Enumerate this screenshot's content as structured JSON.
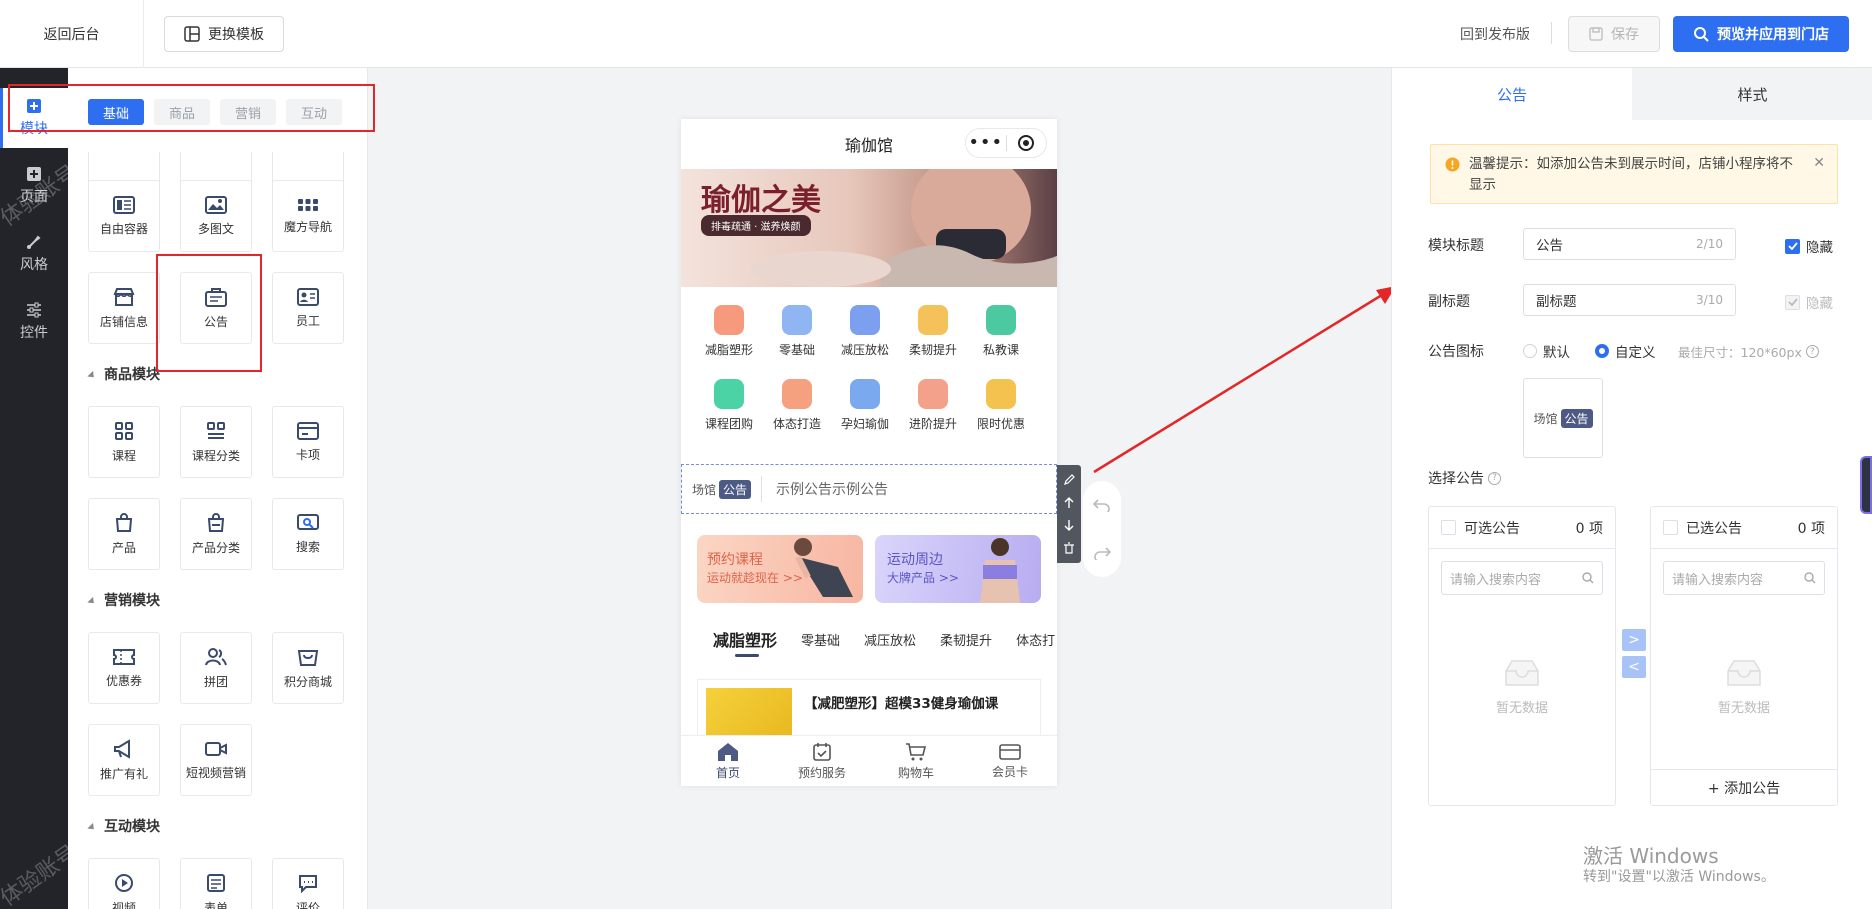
{
  "topbar": {
    "back": "返回后台",
    "change_template": "更换模板",
    "back_to_published": "回到发布版",
    "save": "保存",
    "preview_apply": "预览并应用到门店"
  },
  "sidebar": {
    "items": [
      {
        "label": "模块",
        "icon": "plus-square-icon",
        "active": true
      },
      {
        "label": "页面",
        "icon": "plus-square-icon"
      },
      {
        "label": "风格",
        "icon": "brush-icon"
      },
      {
        "label": "控件",
        "icon": "sliders-icon"
      }
    ],
    "watermark": "体验账号"
  },
  "module_panel": {
    "tabs": [
      "基础",
      "商品",
      "营销",
      "互动"
    ],
    "basic_tiles": [
      "自由容器",
      "多图文",
      "魔方导航",
      "店铺信息",
      "公告",
      "员工"
    ],
    "goods_title": "商品模块",
    "goods_tiles": [
      "课程",
      "课程分类",
      "卡项",
      "产品",
      "产品分类",
      "搜索"
    ],
    "marketing_title": "营销模块",
    "marketing_tiles": [
      "优惠券",
      "拼团",
      "积分商城",
      "推广有礼",
      "短视频营销"
    ],
    "interact_title": "互动模块",
    "interact_tiles": [
      "视频",
      "表单",
      "评价"
    ]
  },
  "phone": {
    "title": "瑜伽馆",
    "banner_title": "瑜伽之美",
    "banner_sub": "排毒疏通 · 滋养焕颜",
    "grid": [
      "减脂塑形",
      "零基础",
      "减压放松",
      "柔韧提升",
      "私教课",
      "课程团购",
      "体态打造",
      "孕妇瑜伽",
      "进阶提升",
      "限时优惠"
    ],
    "grid_colors": [
      "#f59a7d",
      "#8fb5f3",
      "#7c9ff0",
      "#f4c15a",
      "#4cc9a0",
      "#4cd3a5",
      "#f5a07e",
      "#7aa9ef",
      "#f3a18a",
      "#f4c24e"
    ],
    "notice_prefix": "场馆",
    "notice_tag": "公告",
    "notice_text": "示例公告示例公告",
    "promo1_title": "预约课程",
    "promo1_sub": "运动就趁现在 >>",
    "promo2_title": "运动周边",
    "promo2_sub": "大牌产品  >>",
    "category_tabs": [
      "减脂塑形",
      "零基础",
      "减压放松",
      "柔韧提升",
      "体态打"
    ],
    "course_title": "【减肥塑形】超模33健身瑜伽课",
    "bottom_nav": [
      "首页",
      "预约服务",
      "购物车",
      "会员卡"
    ]
  },
  "right_panel": {
    "tabs": [
      "公告",
      "样式"
    ],
    "tip": "温馨提示：如添加公告未到展示时间，店铺小程序将不显示",
    "module_title_label": "模块标题",
    "module_title_value": "公告",
    "module_title_count": "2/10",
    "hide": "隐藏",
    "subtitle_label": "副标题",
    "subtitle_placeholder": "副标题",
    "subtitle_count": "3/10",
    "icon_label": "公告图标",
    "radio_default": "默认",
    "radio_custom": "自定义",
    "best_size": "最佳尺寸：120*60px",
    "icon_preview_prefix": "场馆",
    "icon_preview_tag": "公告",
    "select_label": "选择公告",
    "available_title": "可选公告",
    "available_count": "0 项",
    "selected_title": "已选公告",
    "selected_count": "0 项",
    "search_placeholder": "请输入搜索内容",
    "empty": "暂无数据",
    "add_notice": "+ 添加公告"
  },
  "windows": {
    "line1": "激活 Windows",
    "line2": "转到\"设置\"以激活 Windows。"
  },
  "colors": {
    "accent": "#2e6ff2",
    "highlight": "#e32626",
    "sidebar": "#22242a"
  }
}
